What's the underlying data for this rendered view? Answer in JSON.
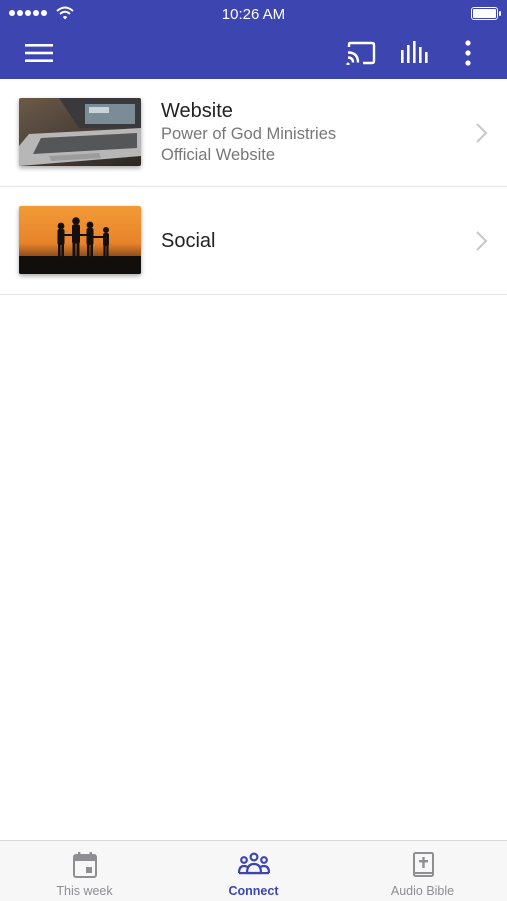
{
  "status_bar": {
    "time": "10:26 AM"
  },
  "app_bar": {
    "menu_icon": "hamburger-menu-icon",
    "cast_icon": "cast-icon",
    "audio_icon": "audio-bars-icon",
    "more_icon": "more-vertical-icon",
    "color": "#3c45b0"
  },
  "list": {
    "items": [
      {
        "title": "Website",
        "subtitle_line1": "Power of God Ministries",
        "subtitle_line2": "Official Website",
        "thumbnail": "laptop-photo"
      },
      {
        "title": "Social",
        "thumbnail": "silhouettes-sunset-photo"
      }
    ]
  },
  "tabs": [
    {
      "label": "This week",
      "icon": "calendar-icon",
      "active": false
    },
    {
      "label": "Connect",
      "icon": "group-icon",
      "active": true
    },
    {
      "label": "Audio Bible",
      "icon": "bible-icon",
      "active": false
    }
  ]
}
